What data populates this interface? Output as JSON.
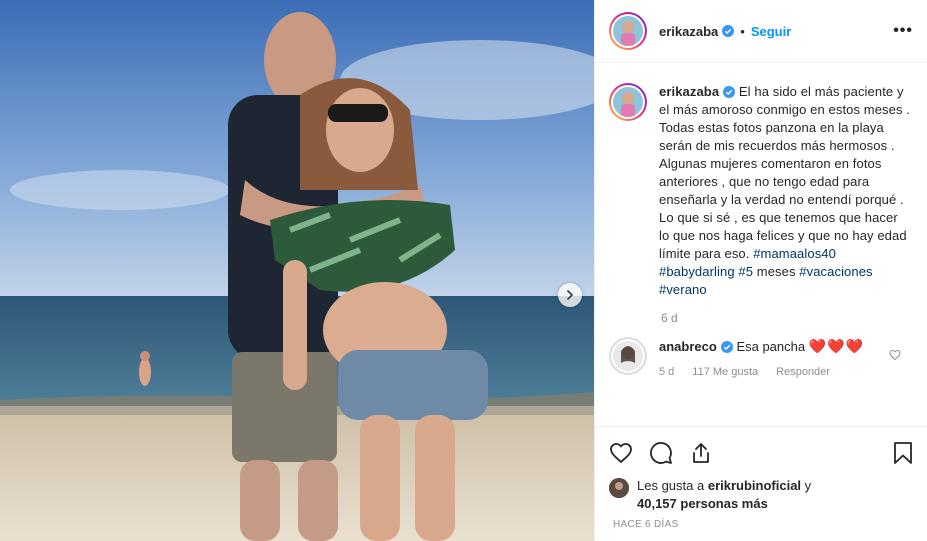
{
  "post": {
    "author": "erikazaba",
    "follow_label": "Seguir",
    "dot": "•",
    "more_label": "•••"
  },
  "caption": {
    "author": "erikazaba",
    "text": "El ha sido el más paciente y el más amoroso conmigo en estos meses . Todas estas fotos panzona en la playa serán de mis recuerdos más hermosos . Algunas mujeres comentaron en fotos anteriores , que no tengo edad para enseñarla y la verdad no entendí porqué . Lo que si sé , es que tenemos que hacer lo que nos haga felices y que no hay edad límite para eso.",
    "hashtags": [
      "#mamaalos40",
      "#babydarling",
      "#5",
      "meses",
      "#vacaciones",
      "#verano"
    ],
    "age": "6 d"
  },
  "comment": {
    "author": "anabreco",
    "text": "Esa pancha",
    "hearts": "❤️❤️❤️",
    "age": "5 d",
    "likes": "117 Me gusta",
    "reply_label": "Responder"
  },
  "likes": {
    "prefix": "Les gusta a",
    "user": "erikrubinoficial",
    "conj": "y",
    "count": "40,157",
    "suffix": "personas más"
  },
  "date": "HACE 6 DÍAS",
  "colors": {
    "link_blue": "#0095f6",
    "hashtag": "#003569",
    "verified": "#3897f0",
    "muted": "#8e8e8e"
  },
  "icons": [
    "chevron-right-icon",
    "verified-icon",
    "heart-icon",
    "comment-icon",
    "share-icon",
    "bookmark-icon"
  ]
}
